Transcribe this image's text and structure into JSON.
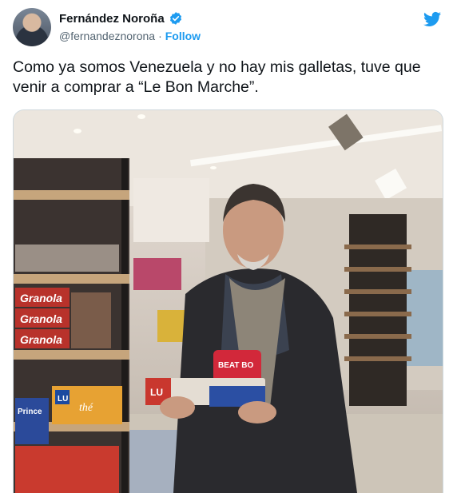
{
  "author": {
    "display_name": "Fernández Noroña",
    "handle": "@fernandeznorona",
    "separator": "·",
    "follow_label": "Follow"
  },
  "tweet": {
    "text_line1": "Como ya somos Venezuela y no hay mis galletas, tuve que",
    "text_line2": "venir a comprar a “Le Bon Marche”."
  },
  "photo": {
    "shelf_labels": [
      "Granola",
      "Granola",
      "Granola",
      "Prince",
      "LU",
      "thé",
      "LU",
      "BEAT BO"
    ]
  },
  "colors": {
    "accent": "#1d9bf0",
    "text": "#0f1419",
    "muted": "#536471"
  },
  "icons": {
    "verified": "verified-badge-icon",
    "brand": "twitter-bird-icon"
  }
}
